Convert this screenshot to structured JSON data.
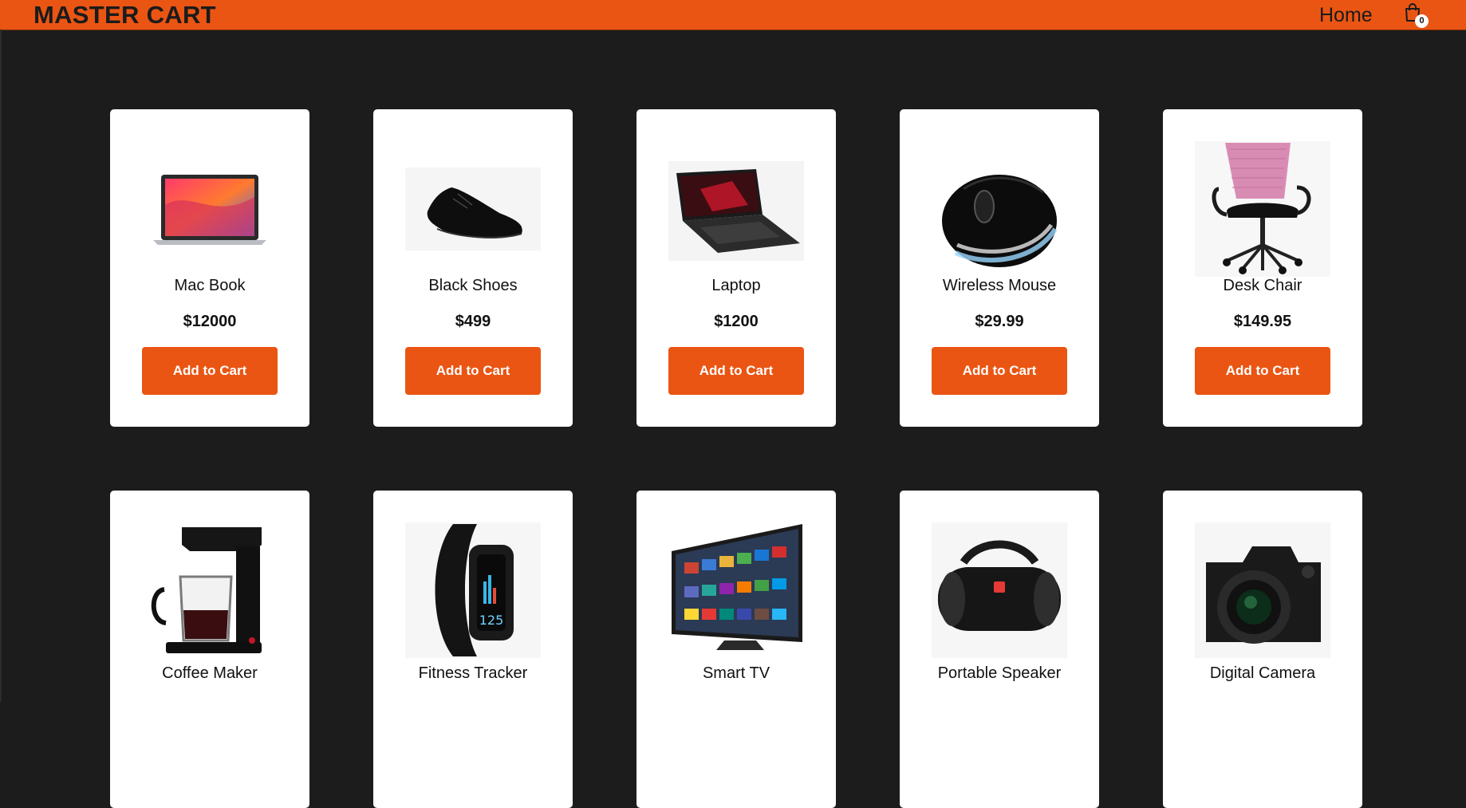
{
  "header": {
    "brand": "MASTER CART",
    "nav_home": "Home",
    "cart_icon": "shopping-bag-icon",
    "cart_count": "0"
  },
  "colors": {
    "accent": "#ea5513",
    "background": "#1c1c1c",
    "card": "#ffffff"
  },
  "products": [
    {
      "name": "Mac Book",
      "price": "$12000",
      "button": "Add to Cart",
      "image": "laptop-macbook-image"
    },
    {
      "name": "Black Shoes",
      "price": "$499",
      "button": "Add to Cart",
      "image": "black-shoe-image"
    },
    {
      "name": "Laptop",
      "price": "$1200",
      "button": "Add to Cart",
      "image": "gaming-laptop-image"
    },
    {
      "name": "Wireless Mouse",
      "price": "$29.99",
      "button": "Add to Cart",
      "image": "wireless-mouse-image"
    },
    {
      "name": "Desk Chair",
      "price": "$149.95",
      "button": "Add to Cart",
      "image": "desk-chair-image"
    },
    {
      "name": "Coffee Maker",
      "image": "coffee-maker-image"
    },
    {
      "name": "Fitness Tracker",
      "image": "fitness-tracker-image"
    },
    {
      "name": "Smart TV",
      "image": "smart-tv-image"
    },
    {
      "name": "Portable Speaker",
      "image": "portable-speaker-image"
    },
    {
      "name": "Digital Camera",
      "image": "digital-camera-image"
    }
  ]
}
